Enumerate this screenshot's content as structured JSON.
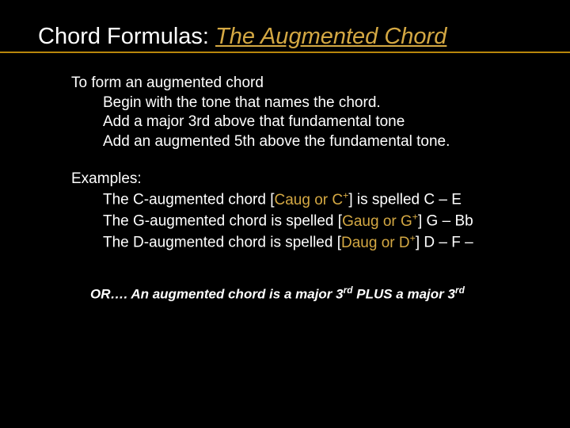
{
  "title": {
    "part1": "Chord Formulas:  ",
    "part2": "The Augmented Chord"
  },
  "intro": {
    "line1": "To form an augmented chord",
    "line2": "Begin with the tone that names the chord.",
    "line3": "Add a major 3rd above that fundamental tone",
    "line4": "Add an augmented 5th above the fundamental tone."
  },
  "examples": {
    "heading": "Examples:",
    "l1a": "The  C-augmented chord   [",
    "l1b": "Caug or C",
    "l1sup": "+",
    "l1c": "] is spelled  C – E",
    "l2a": " The G-augmented chord is spelled [",
    "l2b": "Gaug or G",
    "l2sup": "+",
    "l2c": "] G – Bb",
    "l3a": " The D-augmented  chord is spelled [",
    "l3b": "Daug or D",
    "l3sup": "+",
    "l3c": "] D – F –"
  },
  "footnote": {
    "a": "OR…. An augmented chord is a major 3",
    "ord1": "rd",
    "b": "  PLUS a major 3",
    "ord2": "rd"
  }
}
